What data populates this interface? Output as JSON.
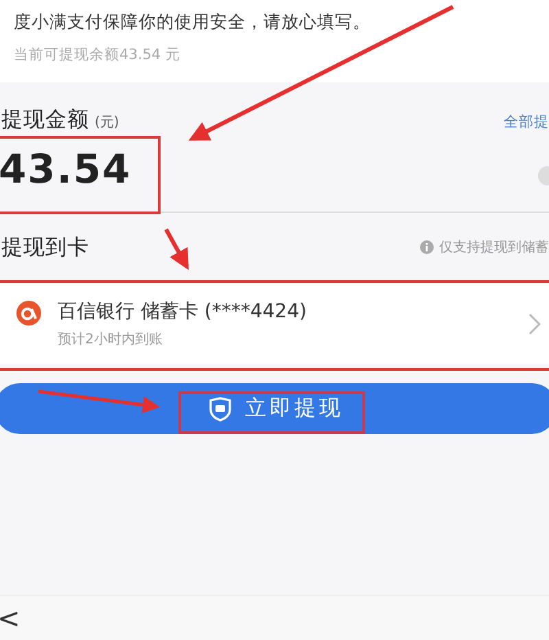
{
  "notice": {
    "message": "度小满支付保障你的使用安全，请放心填写。",
    "balance": "当前可提现余额43.54 元"
  },
  "amount": {
    "label": "提现金额",
    "unit": "(元)",
    "link": "全部提",
    "value": "43.54"
  },
  "card_section": {
    "label": "提现到卡",
    "hint": "仅支持提现到储蓄"
  },
  "card": {
    "name": "百信银行 储蓄卡 (****4424)",
    "eta": "预计2小时内到账"
  },
  "submit": {
    "label": "立即提现"
  },
  "nav": {
    "back": "<"
  }
}
